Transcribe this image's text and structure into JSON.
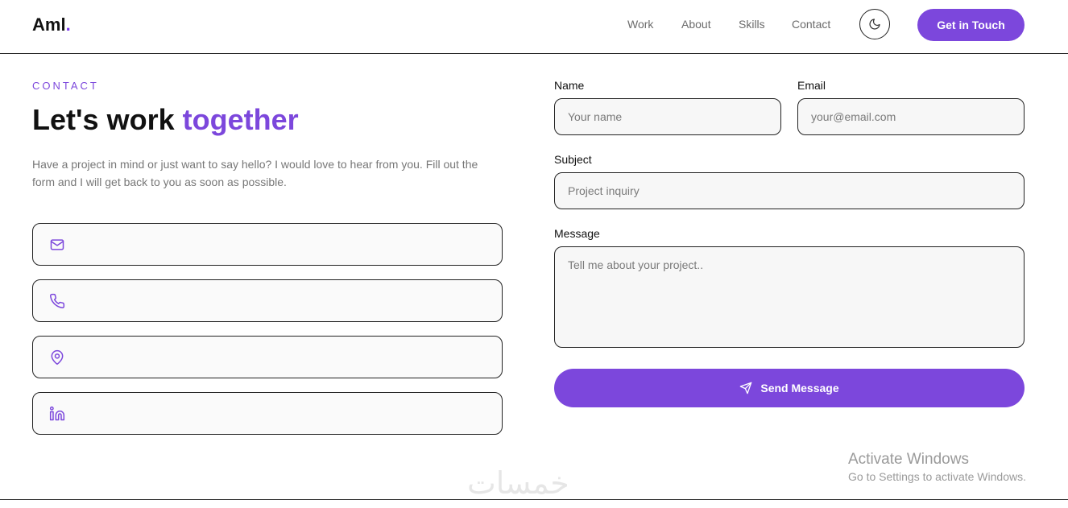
{
  "header": {
    "logo_text": "Aml",
    "logo_dot": ".",
    "nav": [
      "Work",
      "About",
      "Skills",
      "Contact"
    ],
    "theme_toggle_icon": "moon-icon",
    "cta_label": "Get in Touch"
  },
  "contact": {
    "eyebrow": "CONTACT",
    "heading_main": "Let's work ",
    "heading_accent": "together",
    "intro": "Have a project in mind or just want to say hello? I would love to hear from you. Fill out the form and I will get back to you as soon as possible.",
    "cards": [
      {
        "icon": "mail-icon"
      },
      {
        "icon": "phone-icon"
      },
      {
        "icon": "location-pin-icon"
      },
      {
        "icon": "linkedin-icon"
      }
    ]
  },
  "form": {
    "name_label": "Name",
    "name_placeholder": "Your name",
    "email_label": "Email",
    "email_placeholder": "your@email.com",
    "subject_label": "Subject",
    "subject_placeholder": "Project inquiry",
    "message_label": "Message",
    "message_placeholder": "Tell me about your project..",
    "send_label": "Send Message",
    "send_icon": "send-icon"
  },
  "overlay": {
    "activate_title": "Activate Windows",
    "activate_sub": "Go to Settings to activate Windows.",
    "site_mark": "خمسات"
  },
  "colors": {
    "accent": "#7c47dc",
    "text": "#111111",
    "muted": "#777777"
  }
}
